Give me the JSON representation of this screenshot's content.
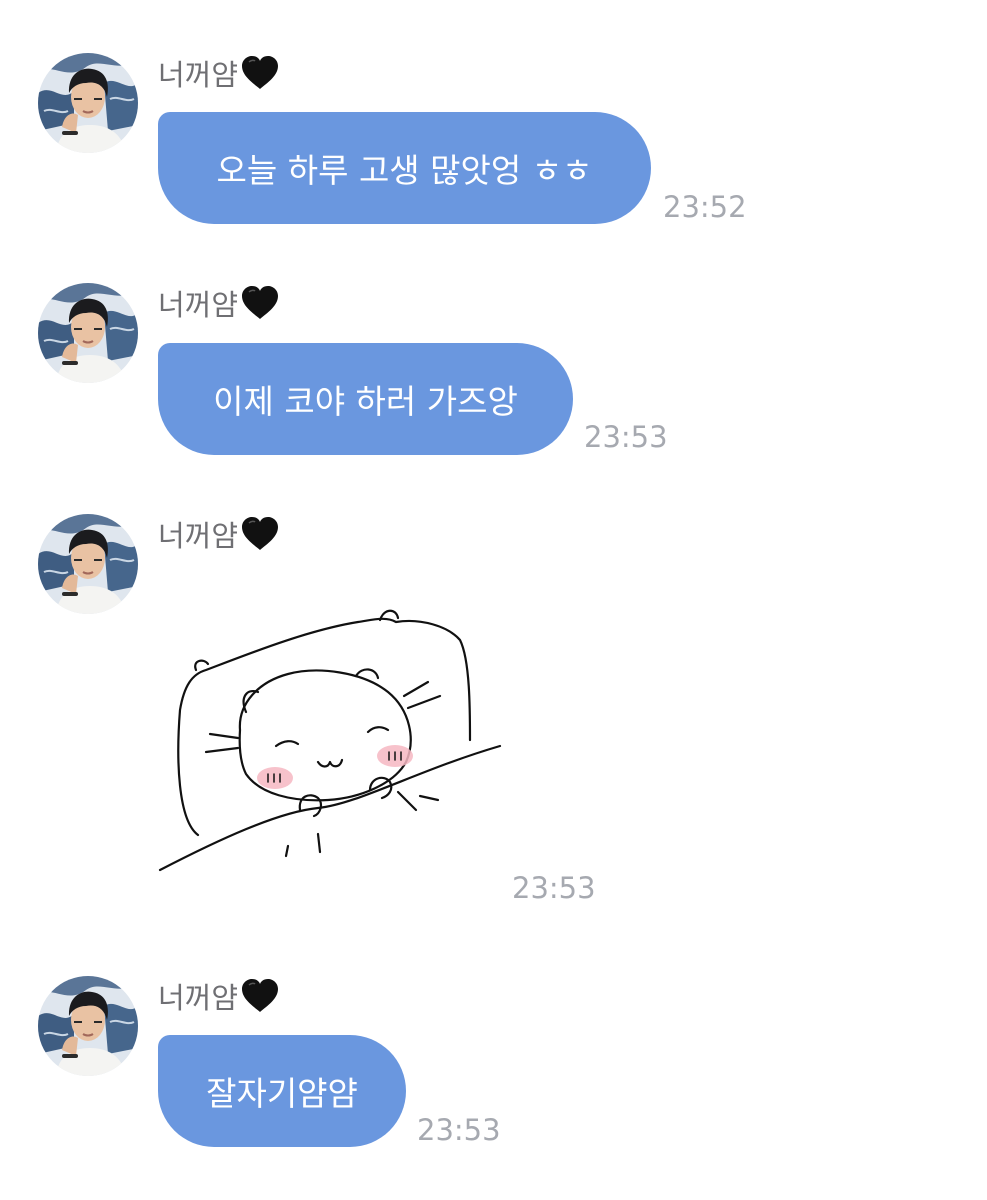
{
  "conversation": {
    "messages": [
      {
        "sender": "너꺼얌",
        "text": "오늘 하루 고생 많앗엉 ㅎㅎ",
        "time": "23:52"
      },
      {
        "sender": "너꺼얌",
        "text": "이제 코야 하러 가즈앙",
        "time": "23:53"
      },
      {
        "sender": "너꺼얌",
        "sticker": "sleeping-cat-sticker",
        "time": "23:53"
      },
      {
        "sender": "너꺼얌",
        "text": "잘자기얌얌",
        "time": "23:53"
      }
    ]
  },
  "icons": {
    "sender_badge": "black-heart-icon",
    "avatar": "profile-photo"
  },
  "colors": {
    "bubble": "#6a97df",
    "bubble_text": "#ffffff",
    "sender_name": "#6f6f73",
    "timestamp": "#a6a9b0",
    "background": "#ffffff"
  }
}
